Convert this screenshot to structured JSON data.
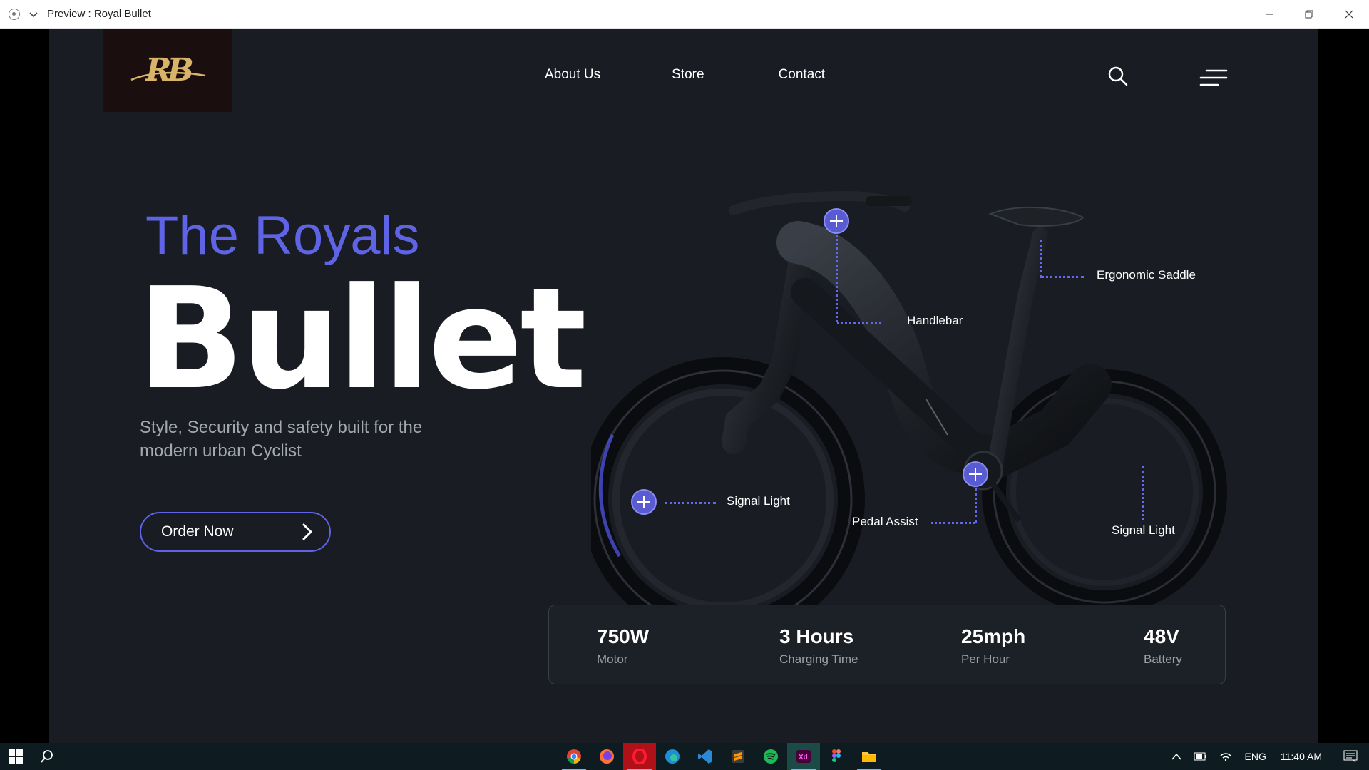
{
  "window": {
    "title": "Preview : Royal Bullet"
  },
  "logo": {
    "text": "RB"
  },
  "nav": {
    "items": [
      "About Us",
      "Store",
      "Contact"
    ]
  },
  "hero": {
    "subtitle": "The Royals",
    "title": "Bullet",
    "description": "Style, Security and safety built for the modern urban Cyclist",
    "cta": "Order Now"
  },
  "callouts": {
    "saddle": "Ergonomic Saddle",
    "handlebar": "Handlebar",
    "signal_front": "Signal Light",
    "pedal": "Pedal Assist",
    "signal_rear": "Signal Light"
  },
  "specs": [
    {
      "value": "750W",
      "label": "Motor"
    },
    {
      "value": "3 Hours",
      "label": "Charging Time"
    },
    {
      "value": "25mph",
      "label": "Per Hour"
    },
    {
      "value": "48V",
      "label": "Battery"
    }
  ],
  "taskbar": {
    "apps": [
      "chrome-icon",
      "firefox-icon",
      "opera-icon",
      "edge-icon",
      "vscode-icon",
      "sublime-icon",
      "spotify-icon",
      "adobe-xd-icon",
      "figma-icon",
      "file-explorer-icon"
    ],
    "language": "ENG",
    "time": "11:40 AM"
  },
  "colors": {
    "accent": "#5f63e6",
    "background": "#191d23",
    "logo_gold": "#d8b46a"
  }
}
